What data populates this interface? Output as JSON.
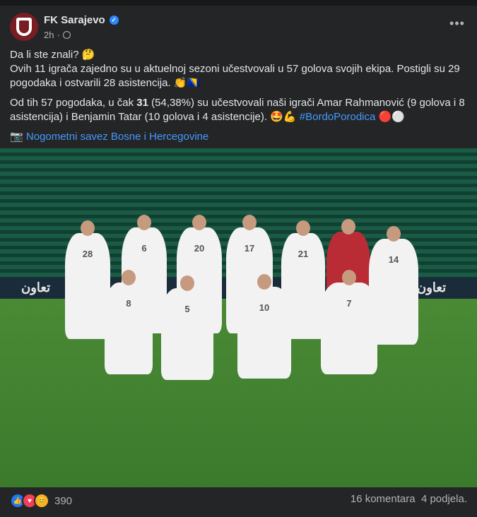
{
  "post": {
    "author": "FK Sarajevo",
    "time": "2h",
    "paragraph1_line1": "Da li ste znali? 🤔",
    "paragraph1_line2": "Ovih 11 igrača zajedno su u aktuelnoj sezoni učestvovali u 57 golova svojih ekipa. Postigli su 29 pogodaka i ostvarili 28 asistencija. 👏🇧🇦",
    "paragraph2_pre": "Od tih 57 pogodaka, u čak ",
    "paragraph2_bold": "31",
    "paragraph2_post": " (54,38%) su učestvovali naši igrači Amar Rahmanović (9 golova i 8 asistencija) i Benjamin Tatar (10 golova i 4 asistencije). 🤩💪 ",
    "hashtag": "#BordoPorodica",
    "hashtag_emoji": " 🔴⚪",
    "credit_prefix": "📷 ",
    "credit_link": "Nogometni savez Bosne i Hercegovine"
  },
  "photo": {
    "ad_text_left": "تعاون",
    "ad_text_right": "تعاون",
    "back_row": [
      "28",
      "6",
      "20",
      "17",
      "21",
      "",
      "14"
    ],
    "front_row": [
      "8",
      "5",
      "10",
      "7"
    ]
  },
  "footer": {
    "reaction_count": "390",
    "comments": "16 komentara",
    "shares": "4 podjela."
  },
  "colors": {
    "background": "#242526",
    "link": "#4599ff",
    "brand": "#7a1c23"
  }
}
